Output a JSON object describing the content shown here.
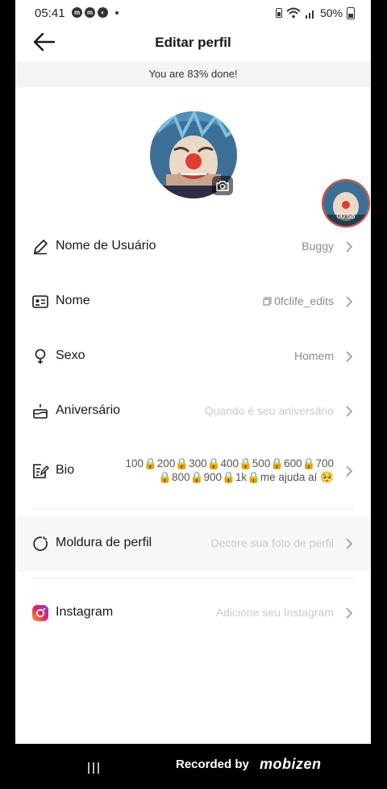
{
  "status_bar": {
    "time": "05:41",
    "battery": "50%"
  },
  "header": {
    "title": "Editar perfil"
  },
  "progress_banner": "You are 83% done!",
  "floating_video": {
    "time": "00:58"
  },
  "rows": [
    {
      "label": "Nome de Usuário",
      "value": "Buggy"
    },
    {
      "label": "Nome",
      "value": "0fclife_edits"
    },
    {
      "label": "Sexo",
      "value": "Homem"
    },
    {
      "label": "Aniversário",
      "value": "Quando é seu aniversário"
    },
    {
      "label": "Bio",
      "value_line1": "100🔒200🔒300🔒400🔒500🔒600🔒700",
      "value_line2": "🔒800🔒900🔒1k🔒me ajuda aí 🥺"
    },
    {
      "label": "Moldura de perfil",
      "value": "Decore sua foto de perfil"
    },
    {
      "label": "Instagram",
      "value": "Adicione seu Instagram"
    }
  ],
  "recording": {
    "prefix": "Recorded by",
    "brand": "mobizen"
  },
  "colors": {
    "text": "#161823",
    "placeholder": "#c9cacd",
    "value": "#8a8b91",
    "banner_bg": "#f4f4f4"
  }
}
